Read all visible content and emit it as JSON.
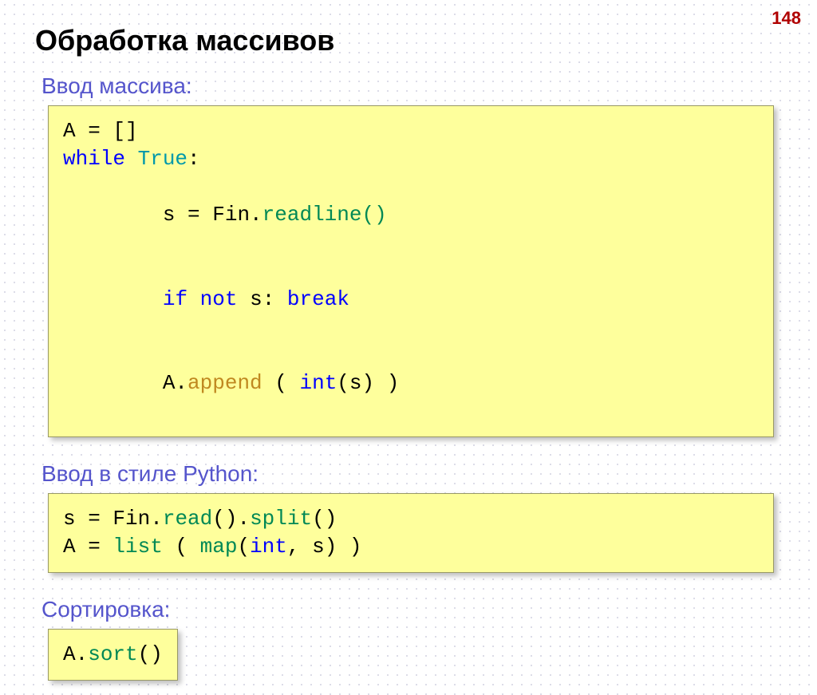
{
  "page_number": "148",
  "title": "Обработка массивов",
  "sections": {
    "input_array": {
      "label": "Ввод массива:",
      "code": {
        "l1_a": "A",
        "l1_eq": " = ",
        "l1_b": "[]",
        "l2_while": "while",
        "l2_true": " True",
        "l2_colon": ":",
        "l3_indent": "  s",
        "l3_eq": " = ",
        "l3_fin": "Fin.",
        "l3_readline": "readline()",
        "l4_indent": "  ",
        "l4_if": "if",
        "l4_not": " not",
        "l4_s": " s: ",
        "l4_break": "break",
        "l5_indent": "  A.",
        "l5_append": "append",
        "l5_open": " ( ",
        "l5_int": "int",
        "l5_close": "(s) )"
      }
    },
    "input_python": {
      "label": "Ввод в стиле Python:",
      "code": {
        "l1_s": "s",
        "l1_eq": " = ",
        "l1_fin": "Fin.",
        "l1_read": "read",
        "l1_dot": "().",
        "l1_split": "split",
        "l1_par": "()",
        "l2_a": "A",
        "l2_eq": " = ",
        "l2_list": "list",
        "l2_open": " ( ",
        "l2_map": "map",
        "l2_mid": "(",
        "l2_int": "int",
        "l2_rest": ", s) )"
      }
    },
    "sort": {
      "label": "Сортировка:",
      "code": {
        "l1_a": "A.",
        "l1_sort": "sort",
        "l1_par": "()"
      }
    }
  }
}
